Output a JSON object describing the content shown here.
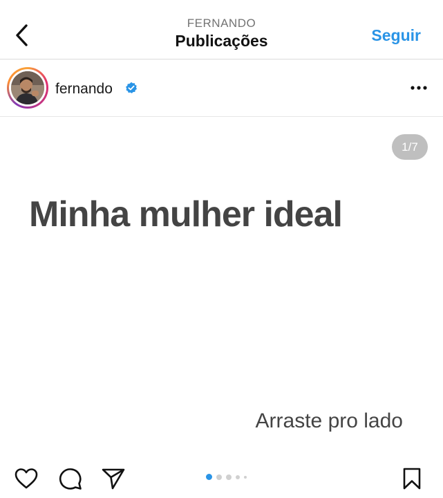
{
  "header": {
    "username_upper": "FERNANDO",
    "title": "Publicações",
    "follow_label": "Seguir"
  },
  "post": {
    "username": "fernando",
    "verified": true,
    "slide_counter": "1/7",
    "headline": "Minha mulher ideal",
    "swipe_hint": "Arraste pro lado",
    "carousel": {
      "total_dots": 5,
      "active_index": 0
    }
  },
  "colors": {
    "accent": "#2a94e6",
    "verified_badge": "#2a94e6",
    "active_dot": "#2a94e6",
    "counter_bg": "#bfbfbf"
  },
  "icons": {
    "back": "chevron-left-icon",
    "more": "more-horizontal-icon",
    "like": "heart-icon",
    "comment": "comment-icon",
    "share": "send-icon",
    "save": "bookmark-icon"
  }
}
